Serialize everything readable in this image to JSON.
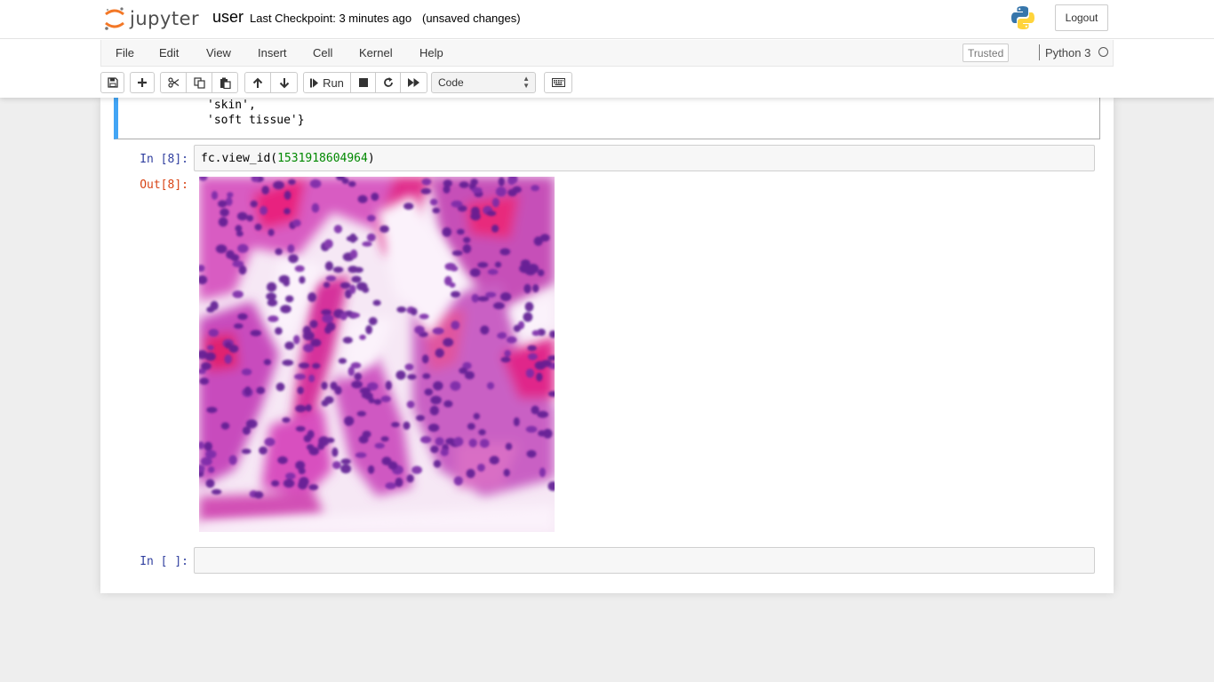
{
  "header": {
    "logo_text": "jupyter",
    "notebook_name": "user",
    "checkpoint": "Last Checkpoint: 3 minutes ago",
    "autosave_status": "(unsaved changes)",
    "logout_label": "Logout"
  },
  "menubar": {
    "items": [
      "File",
      "Edit",
      "View",
      "Insert",
      "Cell",
      "Kernel",
      "Help"
    ],
    "trusted_label": "Trusted",
    "kernel_name": "Python 3"
  },
  "toolbar": {
    "run_label": "Run",
    "cell_type": "Code",
    "icons": [
      "save-icon",
      "plus-icon",
      "cut-icon",
      "copy-icon",
      "paste-icon",
      "arrow-up-icon",
      "arrow-down-icon",
      "step-forward-icon",
      "stop-icon",
      "restart-icon",
      "fast-forward-icon",
      "keyboard-icon"
    ]
  },
  "cells": {
    "previous_output_lines": [
      "'skin',",
      "'soft tissue'}"
    ],
    "cell8": {
      "in_prompt": "In [8]:",
      "code_prefix": "fc.view_id(",
      "code_number": "1531918604964",
      "code_suffix": ")",
      "out_prompt": "Out[8]:",
      "output_image": "histology-tissue-image"
    },
    "empty_cell": {
      "in_prompt": "In [ ]:",
      "code": ""
    }
  },
  "colors": {
    "selected_cell_border": "#42a5f5",
    "in_prompt": "#303f9f",
    "out_prompt": "#d84315",
    "number_literal": "#008800",
    "tissue_stroma": "#e0218a",
    "tissue_nuclei": "#6a1b9a"
  }
}
